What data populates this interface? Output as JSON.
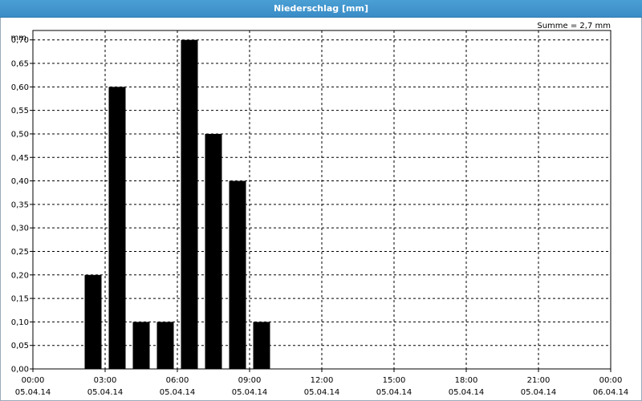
{
  "window": {
    "title": "Niederschlag [mm]"
  },
  "chart_data": {
    "type": "bar",
    "title": "Niederschlag [mm]",
    "ylabel": "mm",
    "annotation": "Summe = 2,7 mm",
    "ylim": [
      0,
      0.72
    ],
    "yticks": [
      "0,00",
      "0,05",
      "0,10",
      "0,15",
      "0,20",
      "0,25",
      "0,30",
      "0,35",
      "0,40",
      "0,45",
      "0,50",
      "0,55",
      "0,60",
      "0,65",
      "0,70"
    ],
    "xlim_hours": [
      0,
      24
    ],
    "xticks": [
      {
        "time": "00:00",
        "date": "05.04.14"
      },
      {
        "time": "03:00",
        "date": "05.04.14"
      },
      {
        "time": "06:00",
        "date": "05.04.14"
      },
      {
        "time": "09:00",
        "date": "05.04.14"
      },
      {
        "time": "12:00",
        "date": "05.04.14"
      },
      {
        "time": "15:00",
        "date": "05.04.14"
      },
      {
        "time": "18:00",
        "date": "05.04.14"
      },
      {
        "time": "21:00",
        "date": "05.04.14"
      },
      {
        "time": "00:00",
        "date": "06.04.14"
      }
    ],
    "bars": [
      {
        "hour": 2.5,
        "value": 0.2
      },
      {
        "hour": 3.5,
        "value": 0.6
      },
      {
        "hour": 4.5,
        "value": 0.1
      },
      {
        "hour": 5.5,
        "value": 0.1
      },
      {
        "hour": 6.5,
        "value": 0.7
      },
      {
        "hour": 7.5,
        "value": 0.5
      },
      {
        "hour": 8.5,
        "value": 0.4
      },
      {
        "hour": 9.5,
        "value": 0.1
      }
    ],
    "grid": true,
    "bar_color": "#000000"
  }
}
